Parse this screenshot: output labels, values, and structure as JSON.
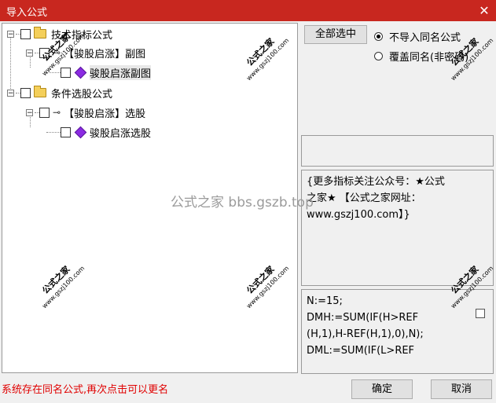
{
  "window": {
    "title": "导入公式",
    "close_glyph": "✕"
  },
  "tree": {
    "items": [
      {
        "label": "技术指标公式"
      },
      {
        "label": "【骏股启涨】副图"
      },
      {
        "label": "骏股启涨副图"
      },
      {
        "label": "条件选股公式"
      },
      {
        "label": "【骏股启涨】选股"
      },
      {
        "label": "骏股启涨选股"
      }
    ],
    "expander_minus": "−"
  },
  "options": {
    "select_all_label": "全部选中",
    "radio_skip_label": "不导入同名公式",
    "radio_overwrite_label": "覆盖同名(非密码)",
    "selected": "不导入同名公式"
  },
  "note": {
    "text": "{更多指标关注公众号：★公式\n之家★ 【公式之家网址：\nwww.gszj100.com】}"
  },
  "code": {
    "text": "N:=15;\nDMH:=SUM(IF(H>REF\n(H,1),H-REF(H,1),0),N);\nDML:=SUM(IF(L>REF"
  },
  "status_text": "系统存在同名公式,再次点击可以更名",
  "buttons": {
    "ok": "确定",
    "cancel": "取消"
  },
  "watermark": {
    "brand": "公式之家",
    "url": "www.gszj100.com",
    "center": "公式之家 bbs.gszb.top"
  }
}
